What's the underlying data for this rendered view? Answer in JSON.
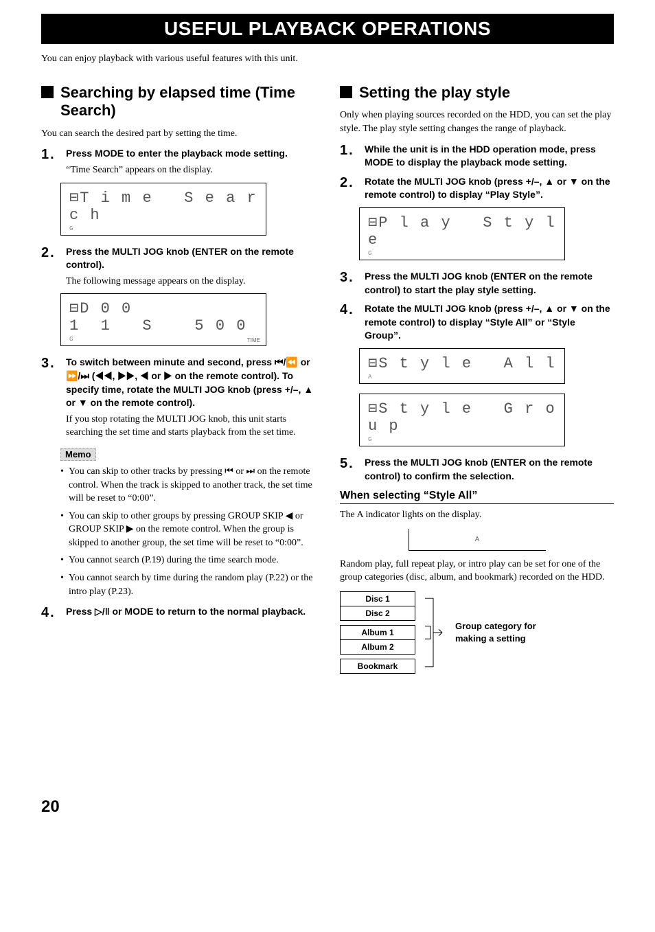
{
  "banner": "USEFUL PLAYBACK OPERATIONS",
  "intro": "You can enjoy playback with various useful features with this unit.",
  "pageNumber": "20",
  "left": {
    "heading": "Searching by elapsed time (Time Search)",
    "lead": "You can search the desired part by setting the time.",
    "step1": {
      "num": "1.",
      "bold": "Press MODE to enter the playback mode setting.",
      "note": "“Time Search” appears on the display."
    },
    "lcd1": {
      "main": "⊟T i m e   S e a r c h",
      "left": "G",
      "right": ""
    },
    "step2": {
      "num": "2.",
      "bold": "Press the MULTI JOG knob (ENTER on the remote control).",
      "note": "The following message appears on the display."
    },
    "lcd2": {
      "main": "⊟D 0 0 1  1   S    5 0 0",
      "left": "G",
      "time": "TIME"
    },
    "step3": {
      "num": "3.",
      "bold": "To switch between minute and second, press ⏮/⏪ or ⏩/⏭ (◀◀, ▶▶, ◀ or ▶ on the remote control). To specify time, rotate the MULTI JOG knob (press +/–, ▲ or ▼ on the remote control).",
      "note": "If you stop rotating the MULTI JOG knob, this unit starts searching the set time and starts playback from the set time."
    },
    "memoHeading": "Memo",
    "memoItems": [
      "You can skip to other tracks by pressing ⏮ or ⏭ on the remote control. When the track is skipped to another track, the set time will be reset to “0:00”.",
      "You can skip to other groups by pressing GROUP SKIP ◀ or GROUP SKIP ▶ on the remote control. When the group is skipped to another group, the set time will be reset to “0:00”.",
      "You cannot search (P.19) during the time search mode.",
      "You cannot search by time during the random play (P.22) or the intro play (P.23)."
    ],
    "step4": {
      "num": "4.",
      "bold": "Press ▷/‖ or MODE to return to the normal playback."
    }
  },
  "right": {
    "heading": "Setting the play style",
    "lead": "Only when playing sources recorded on the HDD, you can set the play style. The play style setting changes the range of playback.",
    "step1": {
      "num": "1.",
      "bold": "While the unit is in the HDD operation mode, press MODE to display the playback mode setting."
    },
    "step2": {
      "num": "2.",
      "bold": "Rotate the MULTI JOG knob (press +/–, ▲ or ▼ on the remote control) to display “Play Style”."
    },
    "lcd1": {
      "main": "⊟P l a y   S t y l e",
      "left": "G"
    },
    "step3": {
      "num": "3.",
      "bold": "Press the MULTI JOG knob (ENTER on the remote control) to start the play style setting."
    },
    "step4": {
      "num": "4.",
      "bold": "Rotate the MULTI JOG knob (press +/–, ▲ or ▼ on the remote control) to display “Style All” or “Style Group”."
    },
    "lcd2": {
      "main": "⊟S t y l e   A l l",
      "left": "A"
    },
    "lcd3": {
      "main": "⊟S t y l e   G r o u p",
      "left": "G"
    },
    "step5": {
      "num": "5.",
      "bold": "Press the MULTI JOG knob (ENTER on the remote control) to confirm the selection."
    },
    "sub1": {
      "heading": "When selecting “Style All”",
      "text": "The A indicator lights on the display.",
      "indicator": "A",
      "text2": "Random play, full repeat play, or intro play can be set for one of the group categories (disc, album, and bookmark) recorded on the HDD."
    },
    "groups": [
      "Disc 1",
      "Disc 2",
      "Album 1",
      "Album 2",
      "Bookmark"
    ],
    "groupCaption": "Group category for making a setting"
  }
}
